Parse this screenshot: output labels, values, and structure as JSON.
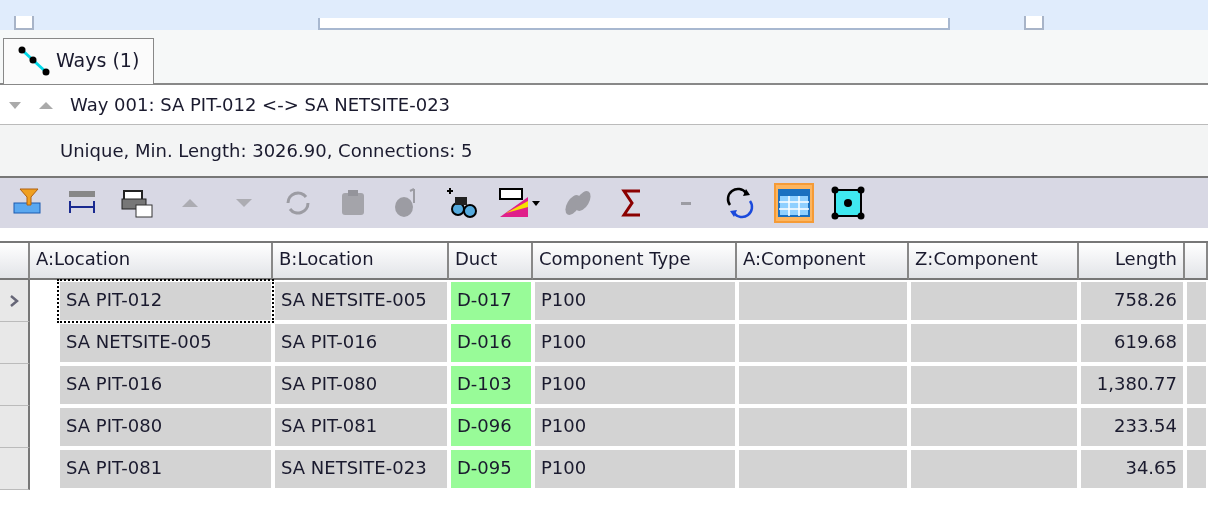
{
  "filter_bar": {
    "checkbox_left": {
      "checked": false
    },
    "checkbox_right": {
      "checked": false
    }
  },
  "tabs": [
    {
      "label": "Ways (1)",
      "selected": true
    }
  ],
  "way": {
    "title": "Way 001: SA PIT-012 <-> SA NETSITE-023",
    "expanded": true,
    "details": "Unique, Min. Length: 3026.90, Connections: 5"
  },
  "toolbar": [
    {
      "disabled": false,
      "selected": false
    },
    {
      "disabled": false,
      "selected": false
    },
    {
      "disabled": false,
      "selected": false
    },
    {
      "disabled": true,
      "selected": false
    },
    {
      "disabled": true,
      "selected": false
    },
    {
      "disabled": true,
      "selected": false
    },
    {
      "disabled": true,
      "selected": false
    },
    {
      "disabled": true,
      "selected": false
    },
    {
      "disabled": false,
      "selected": false
    },
    {
      "disabled": false,
      "selected": false
    },
    {
      "disabled": true,
      "selected": false
    },
    {
      "disabled": false,
      "selected": false
    },
    {
      "disabled": true,
      "selected": false
    },
    {
      "disabled": false,
      "selected": false
    },
    {
      "disabled": false,
      "selected": true
    },
    {
      "disabled": false,
      "selected": false
    }
  ],
  "table": {
    "columns": [
      "A:Location",
      "B:Location",
      "Duct",
      "Component Type",
      "A:Component",
      "Z:Component",
      "Length"
    ],
    "rows": [
      {
        "selected": true,
        "cells": [
          "SA PIT-012",
          "SA NETSITE-005",
          "D-017",
          "P100",
          "",
          "",
          "758.26"
        ]
      },
      {
        "selected": false,
        "cells": [
          "SA NETSITE-005",
          "SA PIT-016",
          "D-016",
          "P100",
          "",
          "",
          "619.68"
        ]
      },
      {
        "selected": false,
        "cells": [
          "SA PIT-016",
          "SA PIT-080",
          "D-103",
          "P100",
          "",
          "",
          "1,380.77"
        ]
      },
      {
        "selected": false,
        "cells": [
          "SA PIT-080",
          "SA PIT-081",
          "D-096",
          "P100",
          "",
          "",
          "233.54"
        ]
      },
      {
        "selected": false,
        "cells": [
          "SA PIT-081",
          "SA NETSITE-023",
          "D-095",
          "P100",
          "",
          "",
          "34.65"
        ]
      }
    ]
  }
}
